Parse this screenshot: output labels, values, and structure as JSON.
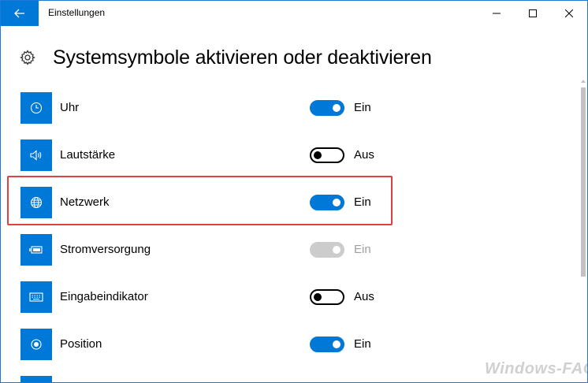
{
  "window": {
    "title": "Einstellungen",
    "accent_color": "#0078d7"
  },
  "header": {
    "title": "Systemsymbole aktivieren oder deaktivieren",
    "icon": "gear-icon"
  },
  "items": [
    {
      "label": "Uhr",
      "icon": "clock-icon",
      "state": "Ein",
      "on": true,
      "disabled": false
    },
    {
      "label": "Lautstärke",
      "icon": "volume-icon",
      "state": "Aus",
      "on": false,
      "disabled": false
    },
    {
      "label": "Netzwerk",
      "icon": "network-globe-icon",
      "state": "Ein",
      "on": true,
      "disabled": false
    },
    {
      "label": "Stromversorgung",
      "icon": "battery-icon",
      "state": "Ein",
      "on": true,
      "disabled": true
    },
    {
      "label": "Eingabeindikator",
      "icon": "keyboard-icon",
      "state": "Aus",
      "on": false,
      "disabled": false
    },
    {
      "label": "Position",
      "icon": "location-icon",
      "state": "Ein",
      "on": true,
      "disabled": false
    }
  ],
  "highlighted_item": "Netzwerk",
  "watermark": "Windows-FAQ"
}
